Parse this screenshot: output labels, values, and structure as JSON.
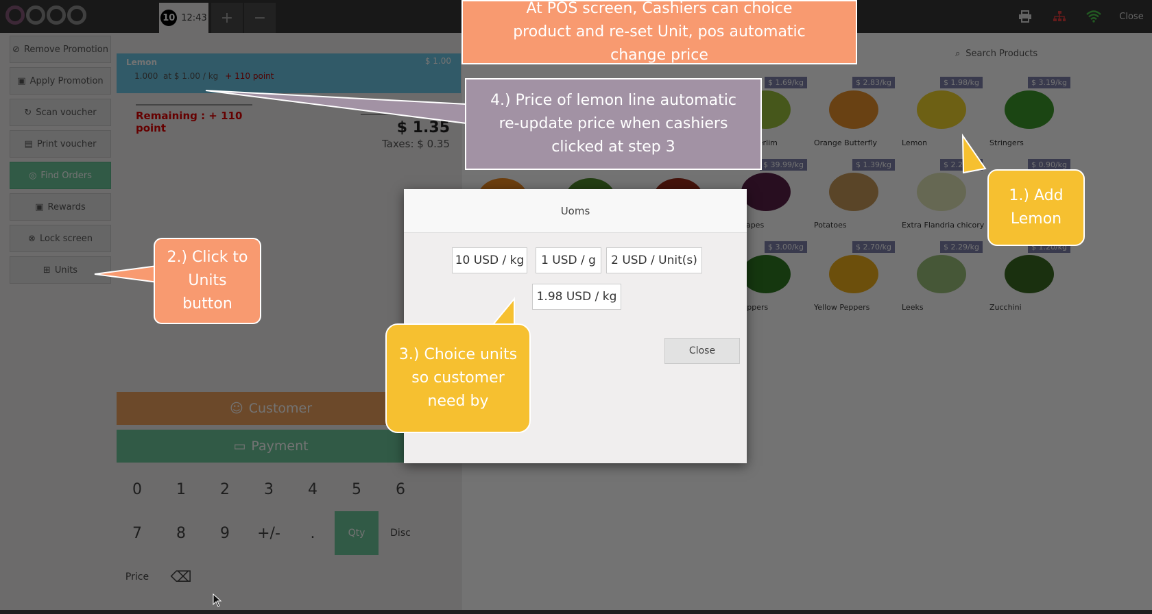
{
  "topbar": {
    "order_number": "10",
    "order_time": "12:43",
    "add_label": "+",
    "remove_label": "−",
    "close_label": "Close",
    "icons": [
      "printer-icon",
      "network-icon",
      "wifi-icon"
    ]
  },
  "controls": [
    {
      "label": "Remove Promotion",
      "icon": "tag-icon"
    },
    {
      "label": "Apply Promotion",
      "icon": "gift-icon"
    },
    {
      "label": "Scan voucher",
      "icon": "refresh-icon"
    },
    {
      "label": "Print voucher",
      "icon": "print-icon"
    },
    {
      "label": "Find Orders",
      "icon": "search-icon",
      "accent": "#6ec89b"
    },
    {
      "label": "Rewards",
      "icon": "gift-icon"
    },
    {
      "label": "Lock screen",
      "icon": "lock-icon"
    },
    {
      "label": "Units",
      "icon": "plus-square-icon"
    }
  ],
  "order": {
    "line_name": "Lemon",
    "line_price": "$ 1.00",
    "line_info": "1.000  at $ 1.00 / kg",
    "line_points": "+ 110 point",
    "remaining": "Remaining : + 110 point",
    "total": "$ 1.35",
    "taxes": "Taxes: $ 0.35"
  },
  "actions": {
    "customer": "Customer",
    "payment": "Payment"
  },
  "numpad": {
    "row1": [
      "0",
      "1",
      "2",
      "3",
      "4",
      "5",
      "6"
    ],
    "row2": [
      "7",
      "8",
      "9",
      "+/-",
      ".",
      "Qty",
      "Disc"
    ],
    "price": "Price",
    "backspace": "⌫"
  },
  "search": {
    "placeholder": "Search Products"
  },
  "products": [
    {
      "name": "Apples Perlim",
      "price": "$ 1.69/kg",
      "color": "#9bc23c"
    },
    {
      "name": "Orange Butterfly",
      "price": "$ 2.83/kg",
      "color": "#e8902a"
    },
    {
      "name": "Lemon",
      "price": "$ 1.98/kg",
      "color": "#f2d62e"
    },
    {
      "name": "Stringers",
      "price": "$ 3.19/kg",
      "color": "#3d9a2a"
    },
    {
      "name": "ck Grapes",
      "price": "$ 39.99/kg",
      "color": "#5a2048"
    },
    {
      "name": "Potatoes",
      "price": "$ 1.39/kg",
      "color": "#c89a5a"
    },
    {
      "name": "Extra Flandria chicory",
      "price": "$ 2.20/kg",
      "color": "#e2e6b8"
    },
    {
      "name": "",
      "price": "$ 0.90/kg",
      "color": "#ffffff"
    },
    {
      "name": "en Peppers",
      "price": "$ 3.00/kg",
      "color": "#2f7a22"
    },
    {
      "name": "Yellow Peppers",
      "price": "$ 2.70/kg",
      "color": "#f0b01c"
    },
    {
      "name": "Leeks",
      "price": "$ 2.29/kg",
      "color": "#9cc07a"
    },
    {
      "name": "Zucchini",
      "price": "$ 1.20/kg",
      "color": "#3a6a22"
    }
  ],
  "modal": {
    "title": "Uoms",
    "options": [
      "10 USD / kg",
      "1 USD / g",
      "2 USD / Unit(s)",
      "1.98 USD / kg"
    ],
    "close_label": "Close"
  },
  "callouts": {
    "intro": "At POS screen, Cashiers can choice product and re-set Unit, pos automatic change price",
    "step1": "1.) Add Lemon",
    "step2": "2.) Click to Units button",
    "step3": "3.) Choice units so customer need by",
    "step4": "4.) Price of lemon line automatic re-update price when cashiers clicked at step 3"
  },
  "colors": {
    "orange_callout": "#f89a70",
    "yellow_callout": "#f6c030",
    "purple_callout": "#a292a4",
    "order_line": "#6ec8e6",
    "green_action": "#6ec89b",
    "orange_action": "#f0a25d"
  }
}
